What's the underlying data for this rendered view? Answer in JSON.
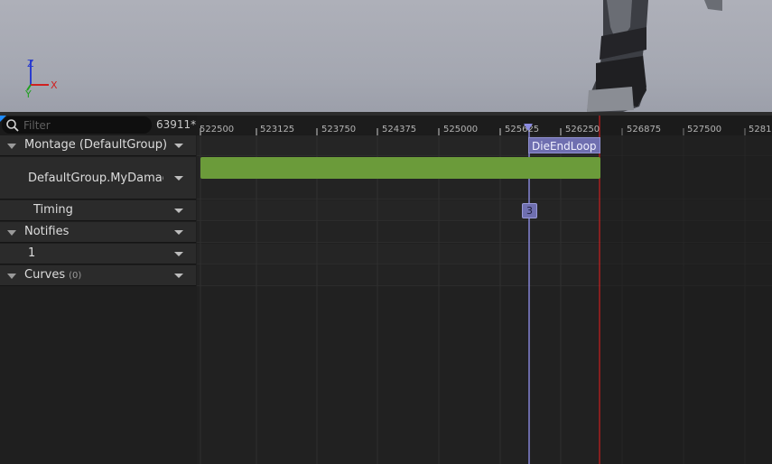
{
  "filter": {
    "placeholder": "Filter",
    "icon": "search-icon"
  },
  "frame_readout": "63911*",
  "tracks": [
    {
      "label": "Montage (DefaultGroup)",
      "expandable": true
    },
    {
      "label": "DefaultGroup.MyDamageS",
      "expandable": false
    },
    {
      "label": "Timing",
      "expandable": false
    },
    {
      "label": "Notifies",
      "expandable": true
    },
    {
      "label": "1",
      "expandable": false
    },
    {
      "label": "Curves",
      "count": "(0)",
      "expandable": true
    }
  ],
  "timeline": {
    "ticks": [
      "522500",
      "523125",
      "523750",
      "524375",
      "525000",
      "525625",
      "526250",
      "526875",
      "527500",
      "5281"
    ],
    "section_name": "DieEndLoop",
    "notify_marker_label": "3",
    "end_marker_color": "#c81e1e",
    "playhead_color": "#8b8be0",
    "section_color": "#6b9b3a"
  },
  "gizmo": {
    "x": "X",
    "y": "Y",
    "z": "Z"
  }
}
